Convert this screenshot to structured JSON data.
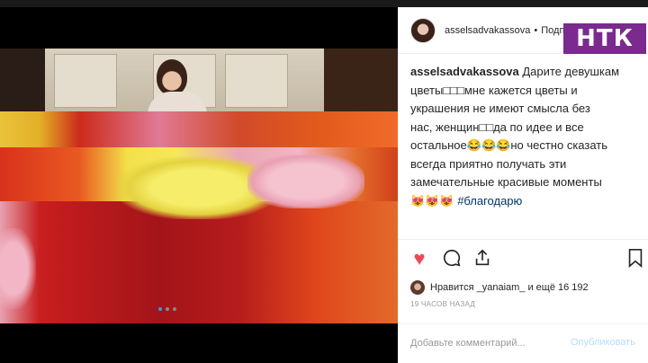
{
  "logo": "НТК",
  "post": {
    "header_username": "asselsadvakassova",
    "header_separator": "•",
    "header_follow": "Подписаться"
  },
  "caption": {
    "username": "asselsadvakassova",
    "line1": "Дарите девушкам",
    "line2": "цветы□□□мне кажется цветы и",
    "line3": "украшения не имеют смысла без",
    "line4": "нас, женщин□□да по идее и все",
    "line5": "остальное😂😂😂но честно сказать",
    "line6": "всегда приятно получать эти",
    "line7": "замечательные красивые моменты",
    "emojis": "😻😻😻",
    "hashtag": "#благодарю"
  },
  "likes": {
    "text": "Нравится _yanaiam_ и ещё 16 192"
  },
  "time": "19 ЧАСОВ НАЗАД",
  "comment": {
    "placeholder": "Добавьте комментарий...",
    "publish": "Опубликовать"
  },
  "icons": {
    "heart": "heart-icon",
    "comment": "comment-icon",
    "share": "share-icon",
    "bookmark": "bookmark-icon"
  }
}
